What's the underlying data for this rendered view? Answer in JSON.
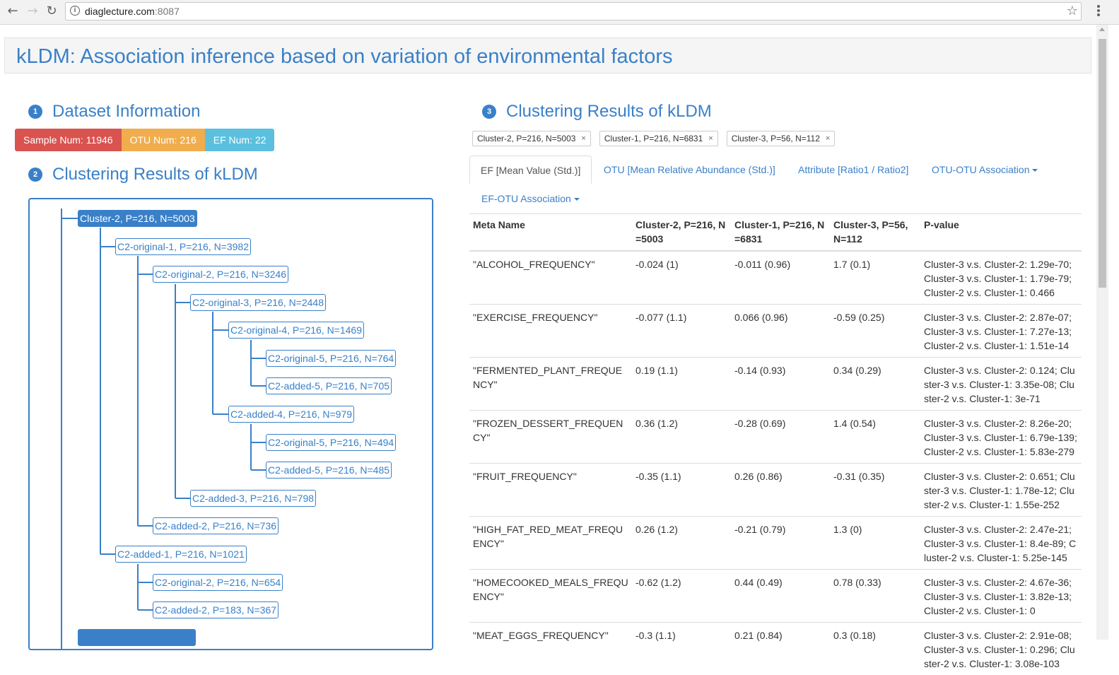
{
  "browser": {
    "url_host": "diaglecture.com",
    "url_port": ":8087"
  },
  "page": {
    "title": "kLDM: Association inference based on variation of environmental factors"
  },
  "section1": {
    "number": "1",
    "title": "Dataset Information"
  },
  "stats": {
    "sample": "Sample Num: 11946",
    "otu": "OTU Num: 216",
    "ef": "EF Num: 22"
  },
  "section2": {
    "number": "2",
    "title": "Clustering Results of kLDM"
  },
  "tree": [
    "Cluster-2, P=216, N=5003",
    "C2-original-1, P=216, N=3982",
    "C2-original-2, P=216, N=3246",
    "C2-original-3, P=216, N=2448",
    "C2-original-4, P=216, N=1469",
    "C2-original-5, P=216, N=764",
    "C2-added-5, P=216, N=705",
    "C2-added-4, P=216, N=979",
    "C2-original-5, P=216, N=494",
    "C2-added-5, P=216, N=485",
    "C2-added-3, P=216, N=798",
    "C2-added-2, P=216, N=736",
    "C2-added-1, P=216, N=1021",
    "C2-original-2, P=216, N=654",
    "C2-added-2, P=183, N=367"
  ],
  "section3": {
    "number": "3",
    "title": "Clustering Results of kLDM"
  },
  "tags": [
    "Cluster-2, P=216, N=5003",
    "Cluster-1, P=216, N=6831",
    "Cluster-3, P=56, N=112"
  ],
  "tag_remove": "×",
  "tabs": {
    "ef": "EF [Mean Value (Std.)]",
    "otu": "OTU [Mean Relative Abundance (Std.)]",
    "attribute": "Attribute [Ratio1 / Ratio2]",
    "otu_otu": "OTU-OTU Association",
    "ef_otu": "EF-OTU Association"
  },
  "table": {
    "headers": [
      "Meta Name",
      "Cluster-2, P=216, N=5003",
      "Cluster-1, P=216, N=6831",
      "Cluster-3, P=56, N=112",
      "P-value"
    ],
    "rows": [
      [
        "\"ALCOHOL_FREQUENCY\"",
        "-0.024 (1)",
        "-0.011 (0.96)",
        "1.7 (0.1)",
        "Cluster-3 v.s. Cluster-2: 1.29e-70; Cluster-3 v.s. Cluster-1: 1.79e-79; Cluster-2 v.s. Cluster-1: 0.466"
      ],
      [
        "\"EXERCISE_FREQUENCY\"",
        "-0.077 (1.1)",
        "0.066 (0.96)",
        "-0.59 (0.25)",
        "Cluster-3 v.s. Cluster-2: 2.87e-07; Cluster-3 v.s. Cluster-1: 7.27e-13; Cluster-2 v.s. Cluster-1: 1.51e-14"
      ],
      [
        "\"FERMENTED_PLANT_FREQUENCY\"",
        "0.19 (1.1)",
        "-0.14 (0.93)",
        "0.34 (0.29)",
        "Cluster-3 v.s. Cluster-2: 0.124; Cluster-3 v.s. Cluster-1: 3.35e-08; Cluster-2 v.s. Cluster-1: 3e-71"
      ],
      [
        "\"FROZEN_DESSERT_FREQUENCY\"",
        "0.36 (1.2)",
        "-0.28 (0.69)",
        "1.4 (0.54)",
        "Cluster-3 v.s. Cluster-2: 8.26e-20; Cluster-3 v.s. Cluster-1: 6.79e-139; Cluster-2 v.s. Cluster-1: 5.83e-279"
      ],
      [
        "\"FRUIT_FREQUENCY\"",
        "-0.35 (1.1)",
        "0.26 (0.86)",
        "-0.31 (0.35)",
        "Cluster-3 v.s. Cluster-2: 0.651; Cluster-3 v.s. Cluster-1: 1.78e-12; Cluster-2 v.s. Cluster-1: 1.55e-252"
      ],
      [
        "\"HIGH_FAT_RED_MEAT_FREQUENCY\"",
        "0.26 (1.2)",
        "-0.21 (0.79)",
        "1.3 (0)",
        "Cluster-3 v.s. Cluster-2: 2.47e-21; Cluster-3 v.s. Cluster-1: 8.4e-89; Cluster-2 v.s. Cluster-1: 5.25e-145"
      ],
      [
        "\"HOMECOOKED_MEALS_FREQUENCY\"",
        "-0.62 (1.2)",
        "0.44 (0.49)",
        "0.78 (0.33)",
        "Cluster-3 v.s. Cluster-2: 4.67e-36; Cluster-3 v.s. Cluster-1: 3.82e-13; Cluster-2 v.s. Cluster-1: 0"
      ],
      [
        "\"MEAT_EGGS_FREQUENCY\"",
        "-0.3 (1.1)",
        "0.21 (0.84)",
        "0.3 (0.18)",
        "Cluster-3 v.s. Cluster-2: 2.91e-08; Cluster-3 v.s. Cluster-1: 0.296; Cluster-2 v.s. Cluster-1: 3.08e-103"
      ]
    ]
  }
}
